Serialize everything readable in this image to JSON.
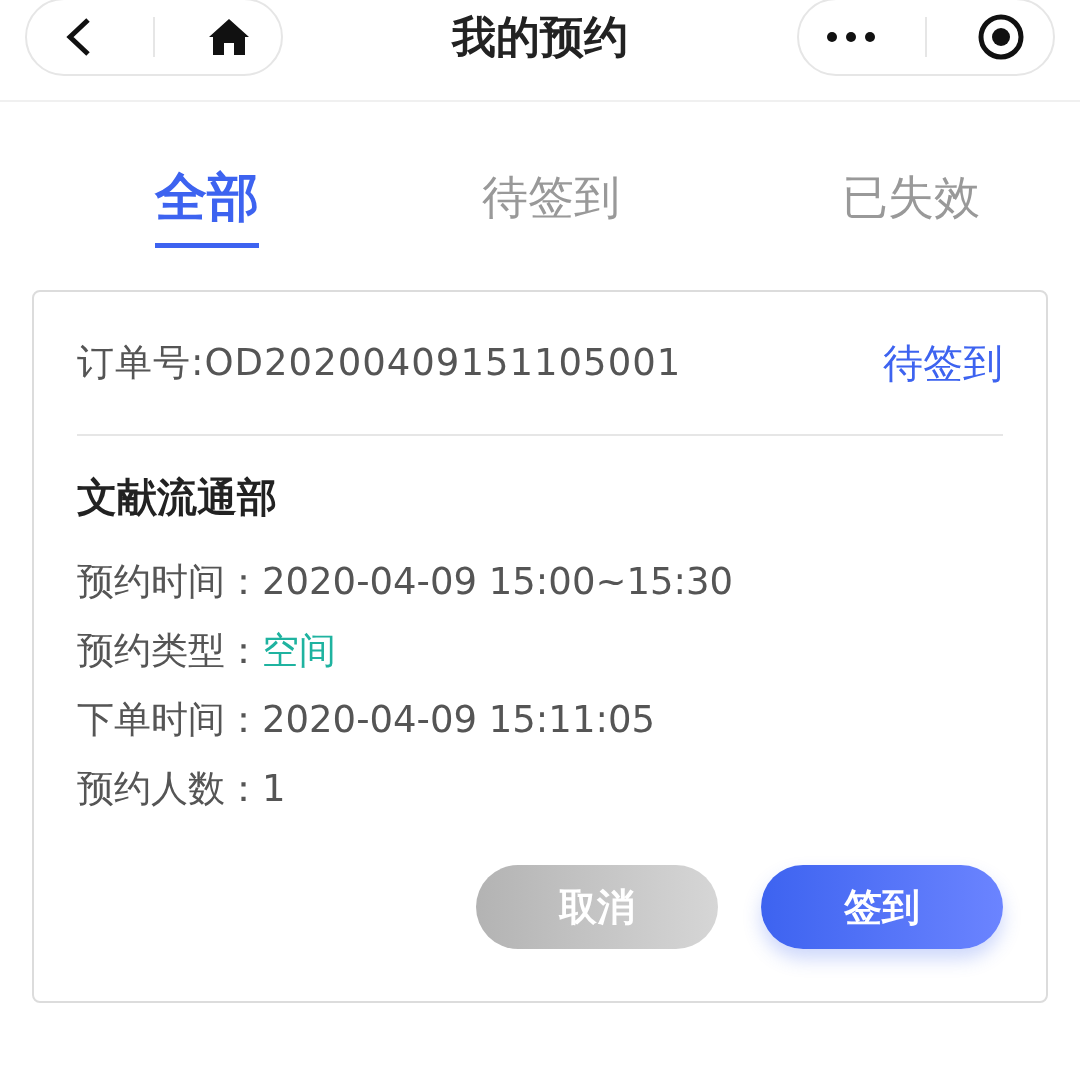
{
  "nav": {
    "title": "我的预约"
  },
  "tabs": [
    {
      "label": "全部",
      "selected": true
    },
    {
      "label": "待签到",
      "selected": false
    },
    {
      "label": "已失效",
      "selected": false
    }
  ],
  "orders": [
    {
      "order_no": "订单号:OD20200409151105001",
      "status": "待签到",
      "title": "文献流通部",
      "fields": [
        {
          "label": "预约时间：",
          "value": "2020-04-09 15:00~15:30",
          "kind": "plain"
        },
        {
          "label": "预约类型：",
          "value": "空间",
          "kind": "highlight"
        },
        {
          "label": "下单时间：",
          "value": "2020-04-09 15:11:05",
          "kind": "plain"
        },
        {
          "label": "预约人数：",
          "value": "1",
          "kind": "plain"
        }
      ],
      "buttons": [
        {
          "label": "取消",
          "kind": "secondary"
        },
        {
          "label": "签到",
          "kind": "primary"
        }
      ]
    }
  ]
}
